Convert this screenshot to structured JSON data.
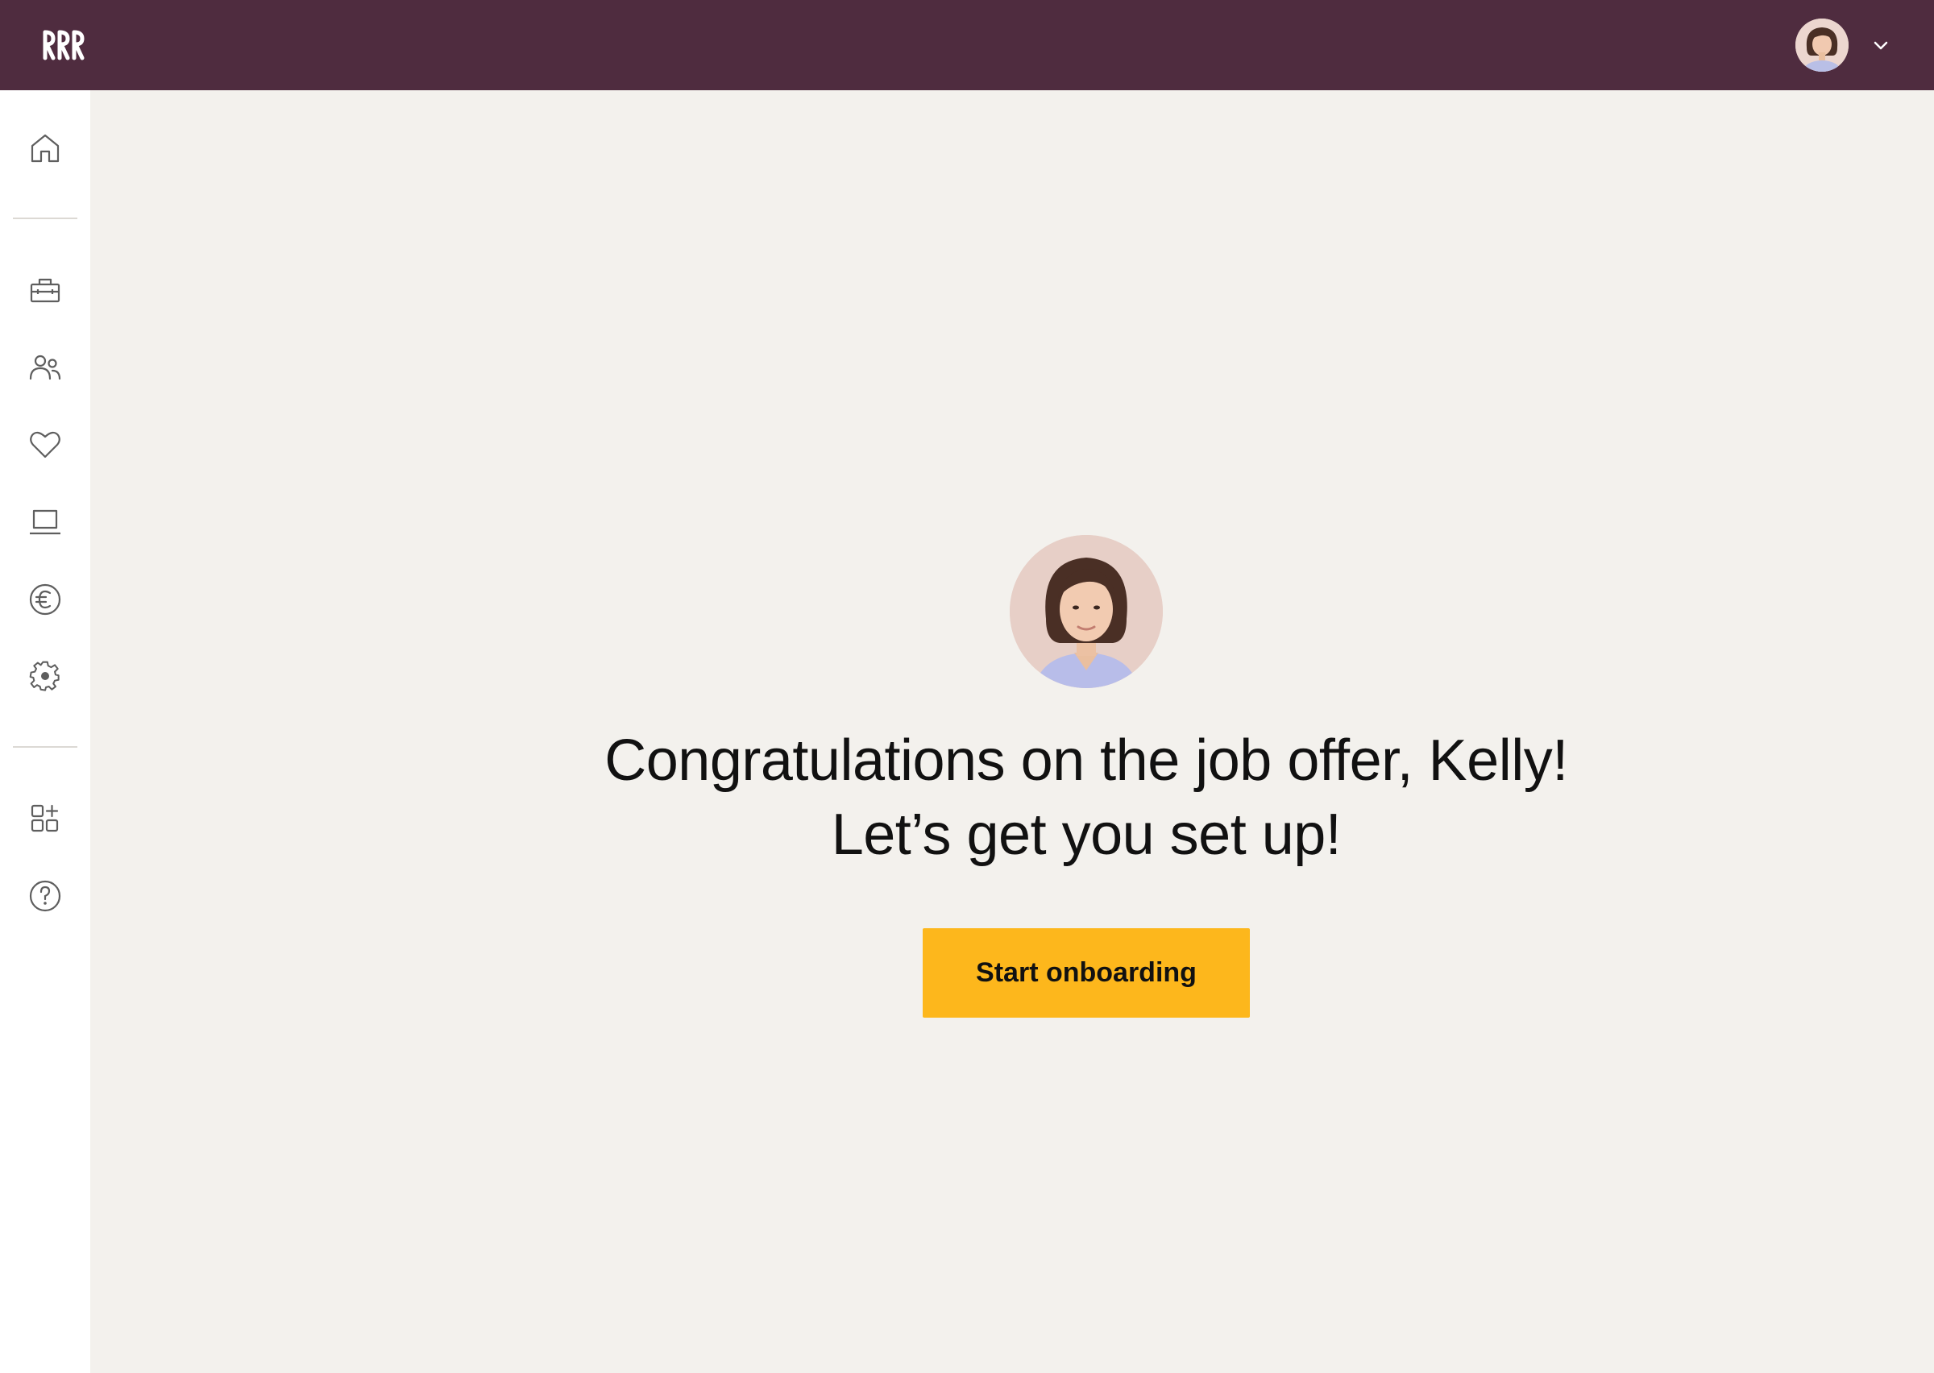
{
  "header": {
    "logo_icon": "brand-logo",
    "user_avatar_icon": "user-avatar",
    "menu_icon": "chevron-down-icon"
  },
  "sidebar": {
    "items": [
      {
        "icon": "home-icon"
      },
      {
        "icon": "toolbox-icon"
      },
      {
        "icon": "people-icon"
      },
      {
        "icon": "heart-icon"
      },
      {
        "icon": "laptop-icon"
      },
      {
        "icon": "euro-icon"
      },
      {
        "icon": "gear-icon"
      },
      {
        "icon": "apps-add-icon"
      },
      {
        "icon": "help-icon"
      }
    ]
  },
  "main": {
    "headline_line1": "Congratulations on the job offer, Kelly!",
    "headline_line2": "Let’s get you set up!",
    "cta_label": "Start onboarding"
  },
  "colors": {
    "header_bg": "#4f2c3f",
    "page_bg": "#f3f1ed",
    "sidebar_bg": "#ffffff",
    "cta_bg": "#fdb71c",
    "icon_stroke": "#5e5e5e"
  }
}
